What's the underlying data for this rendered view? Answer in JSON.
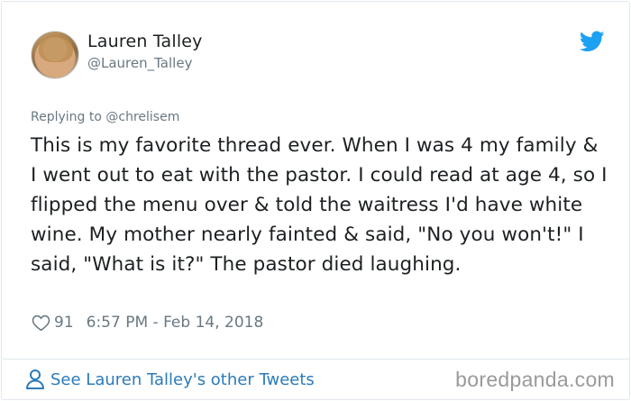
{
  "author": {
    "name": "Lauren Talley",
    "handle": "@Lauren_Talley"
  },
  "reply": {
    "prefix": "Replying to",
    "mention": "@chrelisem"
  },
  "tweet": {
    "text": "This is my favorite thread ever. When I was 4 my family & I went out to eat with the pastor. I could read at age 4, so I flipped the menu over & told the waitress I'd have white wine. My mother nearly fainted & said, \"No you won't!\" I said, \"What is it?\" The pastor died laughing.",
    "likes": "91",
    "timestamp": "6:57 PM - Feb 14, 2018"
  },
  "footer": {
    "link_label": "See Lauren Talley's other Tweets"
  },
  "watermark": "boredpanda.com",
  "icons": {
    "brand": "twitter-bird-icon",
    "like": "heart-icon",
    "profile": "user-icon"
  },
  "colors": {
    "twitter_blue": "#1da1f2",
    "link_blue": "#2b7bb9",
    "muted_text": "#697882",
    "border": "#e1e8ed"
  }
}
